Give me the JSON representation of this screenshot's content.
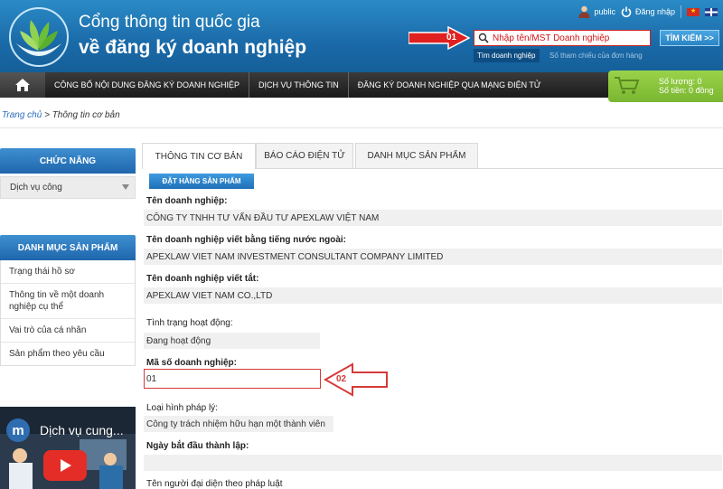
{
  "header": {
    "title_line1": "Cổng thông tin quốc gia",
    "title_line2": "về đăng ký doanh nghiệp",
    "user_label": "public",
    "login_label": "Đăng nhập",
    "search_placeholder": "Nhập tên/MST Doanh nghiệp",
    "search_button": "TÌM KIẾM >>",
    "subtab_active": "Tìm doanh nghiệp",
    "subtab_other": "Số tham chiếu của đơn hàng",
    "callout_01": "01"
  },
  "nav": {
    "items": [
      "CÔNG BỐ NỘI DUNG ĐĂNG KÝ DOANH NGHIỆP",
      "DỊCH VỤ THÔNG TIN",
      "ĐĂNG KÝ DOANH NGHIỆP QUA MẠNG ĐIỆN TỬ"
    ]
  },
  "cart": {
    "quantity_label": "Số lượng: 0",
    "amount_label": "Số tiền: 0 đồng"
  },
  "breadcrumb": {
    "home": "Trang chủ",
    "current": "> Thông tin cơ bản"
  },
  "sidebar": {
    "functions_title": "CHỨC NĂNG",
    "functions_selected": "Dịch vụ công",
    "catalog_title": "DANH MỤC SẢN PHẨM",
    "catalog_items": [
      "Trạng thái hồ sơ",
      "Thông tin về một doanh nghiệp cụ thể",
      "Vai trò của cá nhân",
      "Sản phẩm theo yêu cầu"
    ],
    "video_avatar": "m",
    "video_title": "Dịch vụ cung..."
  },
  "tabs": [
    "THÔNG TIN CƠ BẢN",
    "BÁO CÁO ĐIỆN TỬ",
    "DANH MỤC SẢN PHẨM"
  ],
  "order_button": "ĐẶT HÀNG SẢN PHẨM",
  "fields": {
    "name_label": "Tên doanh nghiệp:",
    "name_value": "CÔNG TY TNHH TƯ VẤN ĐẦU TƯ APEXLAW VIỆT NAM",
    "foreign_label": "Tên doanh nghiệp viết bằng tiếng nước ngoài:",
    "foreign_value": "APEXLAW VIET NAM INVESTMENT CONSULTANT COMPANY LIMITED",
    "short_label": "Tên doanh nghiệp viết tắt:",
    "short_value": "APEXLAW VIET NAM CO.,LTD",
    "status_label": "Tình trạng hoạt động:",
    "status_value": "Đang hoạt động",
    "code_label": "Mã số doanh nghiệp:",
    "code_value": "01",
    "callout_02": "02",
    "type_label": "Loại hình pháp lý:",
    "type_value": "Công ty trách nhiệm hữu hạn một thành viên",
    "date_label": "Ngày bắt đầu thành lập:",
    "rep_label": "Tên người đại diện theo pháp luật"
  },
  "colors": {
    "header_blue": "#1a6aa8",
    "accent_red": "#d41414",
    "nav_dark": "#1a1a1a",
    "cart_green": "#7ab631"
  }
}
